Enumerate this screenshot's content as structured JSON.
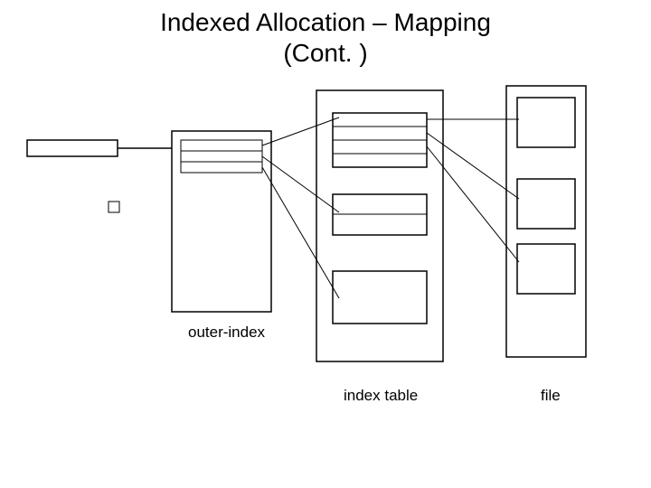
{
  "title_line1": "Indexed Allocation – Mapping",
  "title_line2": "(Cont. )",
  "labels": {
    "outer_index": "outer-index",
    "index_table": "index table",
    "file": "file"
  }
}
